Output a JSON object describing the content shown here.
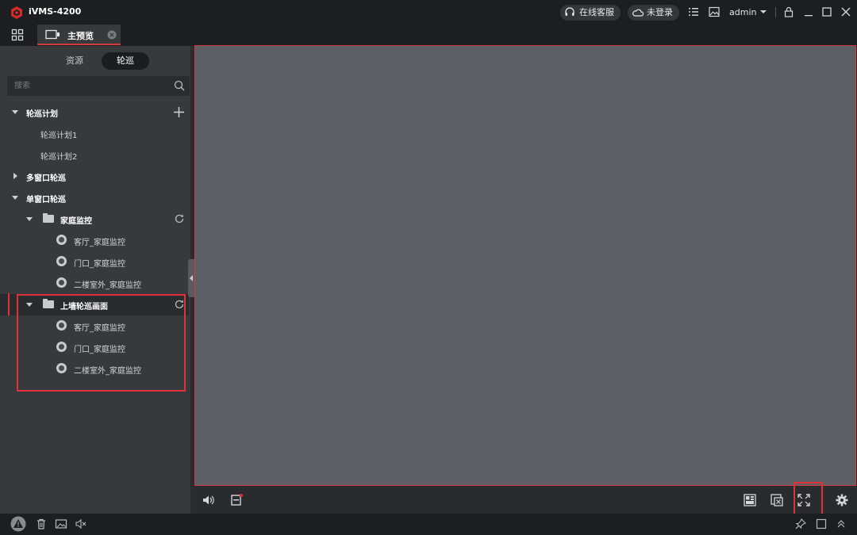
{
  "app": {
    "title": "iVMS-4200"
  },
  "titlebar": {
    "support_label": "在线客服",
    "login_label": "未登录",
    "user": "admin"
  },
  "tabs": [
    {
      "label": "主预览"
    }
  ],
  "sidebar": {
    "segments": {
      "resources": "资源",
      "tour": "轮巡"
    },
    "search_placeholder": "搜索",
    "tree": {
      "tour_plan": {
        "label": "轮巡计划",
        "items": [
          "轮巡计划1",
          "轮巡计划2"
        ]
      },
      "multi_window": {
        "label": "多窗口轮巡"
      },
      "single_window": {
        "label": "单窗口轮巡",
        "groups": [
          {
            "label": "家庭监控",
            "items": [
              "客厅_家庭监控",
              "门口_家庭监控",
              "二楼室外_家庭监控"
            ]
          },
          {
            "label": "上墙轮巡画面",
            "items": [
              "客厅_家庭监控",
              "门口_家庭监控",
              "二楼室外_家庭监控"
            ]
          }
        ]
      }
    }
  },
  "colors": {
    "accent": "#e0303a",
    "viewport": "#5e5f64",
    "sidebar": "#38393d",
    "titlebar": "#1d1e21"
  }
}
